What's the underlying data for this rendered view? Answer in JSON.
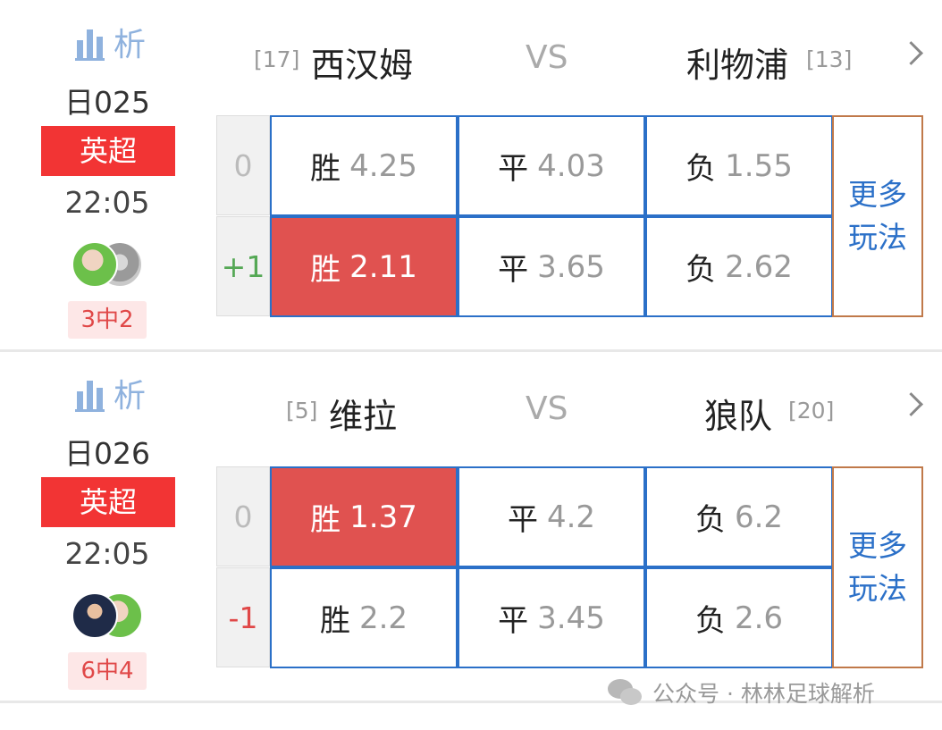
{
  "matches": [
    {
      "analyze_label": "析",
      "code": "日025",
      "league": "英超",
      "time": "22:05",
      "record": "3中2",
      "home": {
        "rank": "[17]",
        "name": "西汉姆"
      },
      "vs": "VS",
      "away": {
        "name": "利物浦",
        "rank": "[13]"
      },
      "rows": [
        {
          "handicap": "0",
          "cells": [
            {
              "label": "胜",
              "odd": "4.25",
              "selected": false
            },
            {
              "label": "平",
              "odd": "4.03",
              "selected": false
            },
            {
              "label": "负",
              "odd": "1.55",
              "selected": false
            }
          ]
        },
        {
          "handicap": "+1",
          "cells": [
            {
              "label": "胜",
              "odd": "2.11",
              "selected": true
            },
            {
              "label": "平",
              "odd": "3.65",
              "selected": false
            },
            {
              "label": "负",
              "odd": "2.62",
              "selected": false
            }
          ]
        }
      ],
      "more": [
        "更多",
        "玩法"
      ]
    },
    {
      "analyze_label": "析",
      "code": "日026",
      "league": "英超",
      "time": "22:05",
      "record": "6中4",
      "home": {
        "rank": "[5]",
        "name": "维拉"
      },
      "vs": "VS",
      "away": {
        "name": "狼队",
        "rank": "[20]"
      },
      "rows": [
        {
          "handicap": "0",
          "cells": [
            {
              "label": "胜",
              "odd": "1.37",
              "selected": true
            },
            {
              "label": "平",
              "odd": "4.2",
              "selected": false
            },
            {
              "label": "负",
              "odd": "6.2",
              "selected": false
            }
          ]
        },
        {
          "handicap": "-1",
          "cells": [
            {
              "label": "胜",
              "odd": "2.2",
              "selected": false
            },
            {
              "label": "平",
              "odd": "3.45",
              "selected": false
            },
            {
              "label": "负",
              "odd": "2.6",
              "selected": false
            }
          ]
        }
      ],
      "more": [
        "更多",
        "玩法"
      ]
    }
  ],
  "watermark": "公众号 · 林林足球解析",
  "colors": {
    "league_bg": "#f23434",
    "selected_bg": "#e05250",
    "cell_border": "#2b70c8",
    "more_border": "#c0794a",
    "analyze": "#8fb2de"
  }
}
